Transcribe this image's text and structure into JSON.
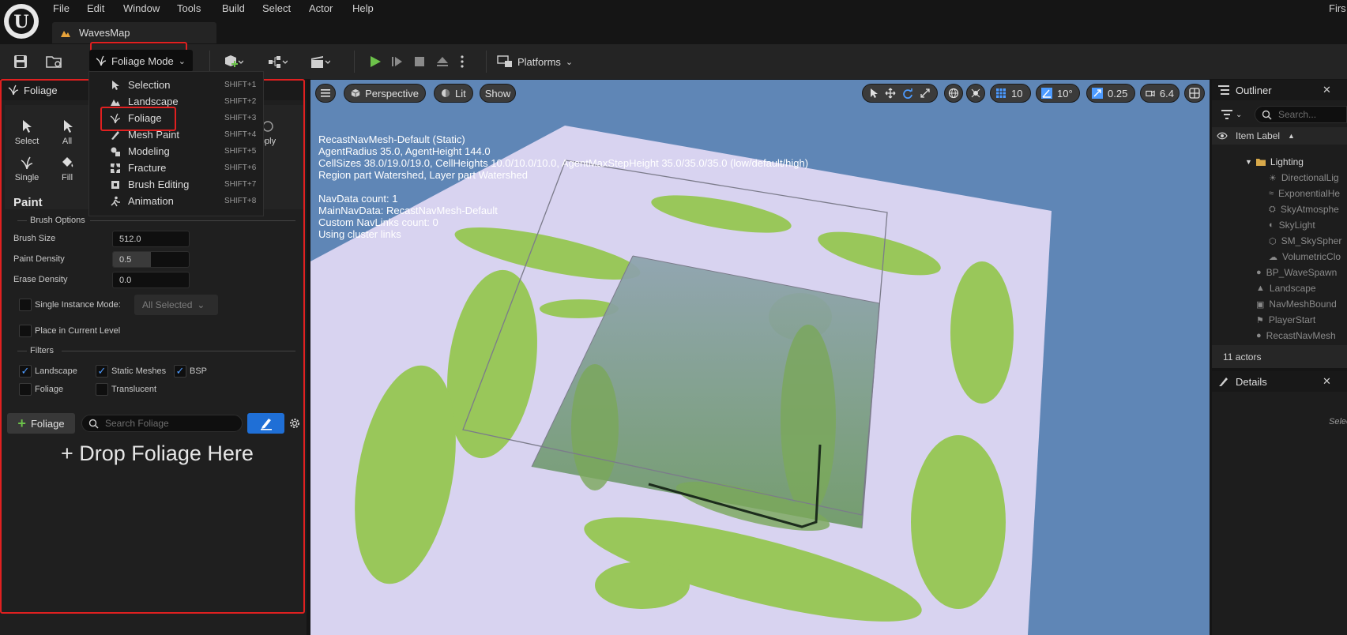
{
  "menubar": {
    "items": [
      "File",
      "Edit",
      "Window",
      "Tools",
      "Build",
      "Select",
      "Actor",
      "Help"
    ],
    "right_text": "Firs"
  },
  "map_tab": {
    "label": "WavesMap"
  },
  "toolbar": {
    "mode_label": "Foliage Mode",
    "platforms_label": "Platforms"
  },
  "mode_dropdown": {
    "items": [
      {
        "label": "Selection",
        "shortcut": "SHIFT+1",
        "icon": "selection-icon"
      },
      {
        "label": "Landscape",
        "shortcut": "SHIFT+2",
        "icon": "landscape-icon"
      },
      {
        "label": "Foliage",
        "shortcut": "SHIFT+3",
        "icon": "foliage-icon"
      },
      {
        "label": "Mesh Paint",
        "shortcut": "SHIFT+4",
        "icon": "mesh-paint-icon"
      },
      {
        "label": "Modeling",
        "shortcut": "SHIFT+5",
        "icon": "modeling-icon"
      },
      {
        "label": "Fracture",
        "shortcut": "SHIFT+6",
        "icon": "fracture-icon"
      },
      {
        "label": "Brush Editing",
        "shortcut": "SHIFT+7",
        "icon": "brush-editing-icon"
      },
      {
        "label": "Animation",
        "shortcut": "SHIFT+8",
        "icon": "animation-icon"
      }
    ]
  },
  "foliage_panel": {
    "title": "Foliage",
    "tools": [
      "Select",
      "All",
      "Single",
      "Fill",
      "pply"
    ],
    "paint_heading": "Paint",
    "brush_options_heading": "Brush Options",
    "brush_size_label": "Brush Size",
    "brush_size_value": "512.0",
    "paint_density_label": "Paint Density",
    "paint_density_value": "0.5",
    "paint_density_fraction": 0.5,
    "erase_density_label": "Erase Density",
    "erase_density_value": "0.0",
    "single_instance_label": "Single Instance Mode:",
    "single_instance_value": "All Selected",
    "place_in_level_label": "Place in Current Level",
    "filters_heading": "Filters",
    "filters": [
      {
        "label": "Landscape",
        "checked": true
      },
      {
        "label": "Static Meshes",
        "checked": true
      },
      {
        "label": "BSP",
        "checked": true
      },
      {
        "label": "Foliage",
        "checked": false
      },
      {
        "label": "Translucent",
        "checked": false
      }
    ],
    "add_button_label": "Foliage",
    "search_placeholder": "Search Foliage",
    "drop_text": "+ Drop Foliage Here"
  },
  "viewport": {
    "perspective_label": "Perspective",
    "lit_label": "Lit",
    "show_label": "Show",
    "grid_snap": "10",
    "rotation_snap": "10°",
    "scale_snap": "0.25",
    "camera_speed": "6.4",
    "overlay_lines": [
      "RecastNavMesh-Default (Static)",
      "AgentRadius 35.0, AgentHeight 144.0",
      "CellSizes 38.0/19.0/19.0, CellHeights 10.0/10.0/10.0, AgentMaxStepHeight 35.0/35.0/35.0 (low/default/high)",
      "Region part Watershed, Layer part Watershed",
      "",
      "NavData count: 1",
      "MainNavData: RecastNavMesh-Default",
      "Custom NavLinks count: 0",
      "Using cluster links"
    ]
  },
  "outliner": {
    "title": "Outliner",
    "search_placeholder": "Search...",
    "column_label": "Item Label",
    "items": [
      {
        "label": "Lighting",
        "level": 1,
        "folder": true
      },
      {
        "label": "DirectionalLig",
        "level": 2
      },
      {
        "label": "ExponentialHe",
        "level": 2
      },
      {
        "label": "SkyAtmosphe",
        "level": 2
      },
      {
        "label": "SkyLight",
        "level": 2
      },
      {
        "label": "SM_SkySpher",
        "level": 2
      },
      {
        "label": "VolumetricClo",
        "level": 2
      },
      {
        "label": "BP_WaveSpawn",
        "level": 1
      },
      {
        "label": "Landscape",
        "level": 1
      },
      {
        "label": "NavMeshBound",
        "level": 1
      },
      {
        "label": "PlayerStart",
        "level": 1
      },
      {
        "label": "RecastNavMesh",
        "level": 1
      }
    ],
    "actor_count": "11 actors"
  },
  "details": {
    "title": "Details",
    "hint": "Select an o"
  },
  "colors": {
    "accent_red": "#e02020",
    "check_blue": "#4d9bff",
    "play_green": "#6cc24a",
    "viewport_sky": "#5f86b6"
  }
}
